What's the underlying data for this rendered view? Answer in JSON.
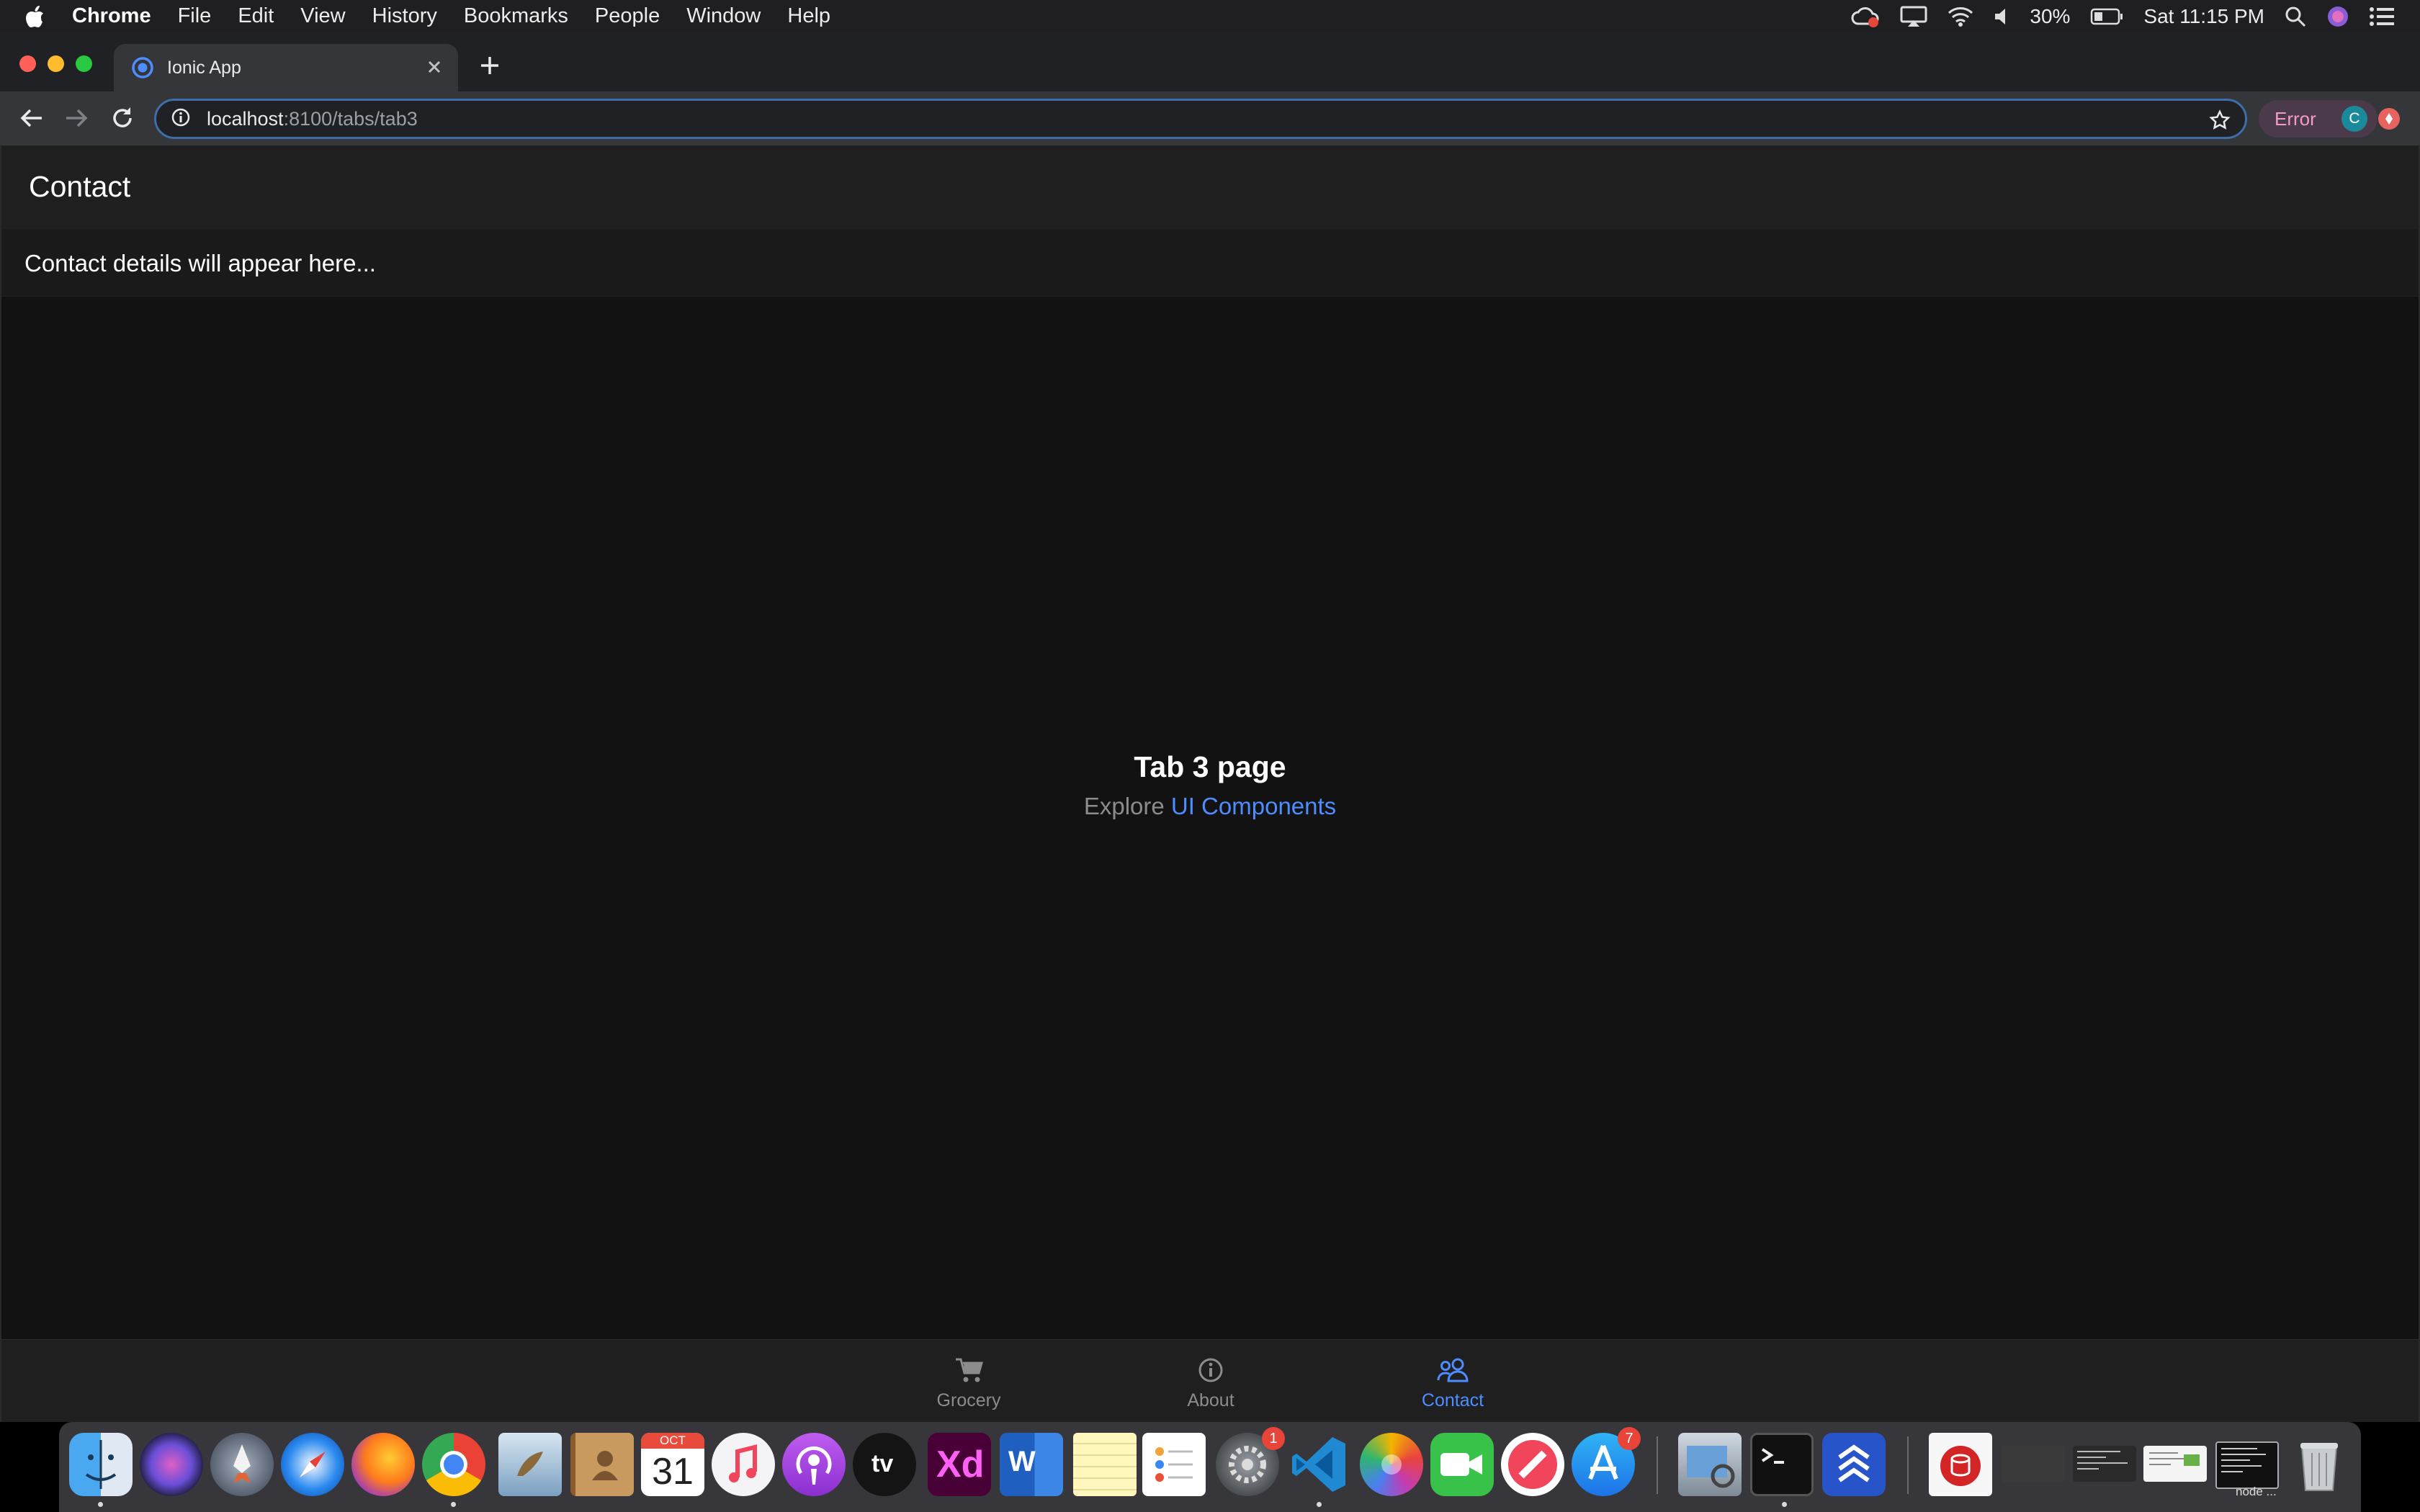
{
  "menubar": {
    "app_name": "Chrome",
    "menus": [
      "File",
      "Edit",
      "View",
      "History",
      "Bookmarks",
      "People",
      "Window",
      "Help"
    ],
    "battery": "30%",
    "clock": "Sat 11:15 PM"
  },
  "browser": {
    "tab_title": "Ionic App",
    "url_host": "localhost",
    "url_path": ":8100/tabs/tab3",
    "profile_label": "Error",
    "profile_initial": "C"
  },
  "app": {
    "header_title": "Contact",
    "subheader_text": "Contact details will appear here...",
    "content_heading": "Tab 3 page",
    "explore_prefix": "Explore",
    "explore_link": "UI Components",
    "tabs": [
      {
        "label": "Grocery",
        "icon": "cart-icon",
        "active": false
      },
      {
        "label": "About",
        "icon": "info-circle-icon",
        "active": false
      },
      {
        "label": "Contact",
        "icon": "people-icon",
        "active": true
      }
    ],
    "colors": {
      "accent": "#4d8dff",
      "background": "#121212",
      "toolbar": "#1f1f1f"
    }
  },
  "dock": {
    "calendar_month": "OCT",
    "calendar_day": "31",
    "xd_label": "Xd",
    "word_label": "W",
    "tv_label": "tv",
    "system_prefs_badge": "1",
    "app_store_badge": "7",
    "node_label": "node ..."
  }
}
